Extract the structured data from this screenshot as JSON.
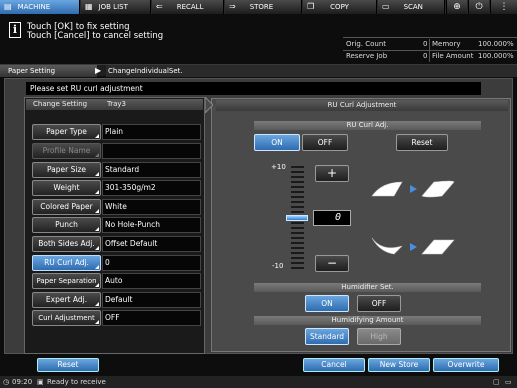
{
  "tabs": [
    {
      "label": "MACHINE",
      "icon": "printer-icon",
      "active": true
    },
    {
      "label": "JOB LIST",
      "icon": "list-icon"
    },
    {
      "label": "RECALL",
      "icon": "recall-icon"
    },
    {
      "label": "STORE",
      "icon": "store-icon"
    },
    {
      "label": "COPY",
      "icon": "copy-icon"
    },
    {
      "label": "SCAN",
      "icon": "scan-icon"
    }
  ],
  "topicons": {
    "globe": "globe-icon",
    "power": "power-icon"
  },
  "message": {
    "line1": "Touch [OK] to fix setting",
    "line2": "Touch [Cancel] to cancel setting"
  },
  "counters": {
    "orig_label": "Orig. Count",
    "orig_value": "0",
    "memory_label": "Memory",
    "memory_value": "100.000%",
    "reserve_label": "Reserve Job",
    "reserve_value": "0",
    "file_label": "File Amount",
    "file_value": "100.000%"
  },
  "breadcrumb": {
    "root": "Paper Setting",
    "current": "ChangeIndividualSet."
  },
  "prompt": "Please set RU curl adjustment",
  "left": {
    "heading": "Change Setting",
    "tray": "Tray3",
    "rows": [
      {
        "label": "Paper Type",
        "value": "Plain"
      },
      {
        "label": "Profile Name",
        "value": ""
      },
      {
        "label": "Paper Size",
        "value": "Standard"
      },
      {
        "label": "Weight",
        "value": "301-350g/m2"
      },
      {
        "label": "Colored Paper",
        "value": "White"
      },
      {
        "label": "Punch",
        "value": "No Hole-Punch"
      },
      {
        "label": "Both Sides Adj.",
        "value": "Offset Default"
      },
      {
        "label": "RU Curl Adj.",
        "value": "0"
      },
      {
        "label": "Paper Separation",
        "value": "Auto"
      },
      {
        "label": "Expert Adj.",
        "value": "Default"
      },
      {
        "label": "Curl Adjustment",
        "value": "OFF"
      }
    ]
  },
  "right": {
    "heading": "RU Curl Adjustment",
    "curl_heading": "RU Curl Adj.",
    "on_label": "ON",
    "off_label": "OFF",
    "reset_label": "Reset",
    "max_label": "+10",
    "min_label": "-10",
    "plus_label": "+",
    "minus_label": "−",
    "value": "0",
    "level": 0,
    "humidifier_heading": "Humidifier Set.",
    "hum_on": "ON",
    "hum_off": "OFF",
    "amount_heading": "Humidifying Amount",
    "standard_label": "Standard",
    "high_label": "High"
  },
  "bottom": {
    "reset": "Reset",
    "cancel": "Cancel",
    "new_store": "New Store",
    "overwrite": "Overwrite"
  },
  "status": {
    "time": "09:20",
    "text": "Ready to receive"
  }
}
